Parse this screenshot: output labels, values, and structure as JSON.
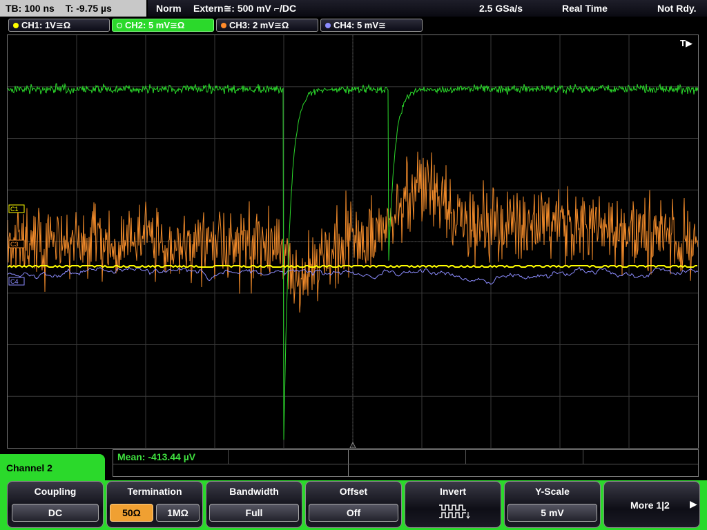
{
  "top_bar": {
    "timebase": "TB: 100 ns",
    "trigger_time": "T: -9.75 µs",
    "acq_mode": "Norm",
    "trigger": "Extern≅: 500 mV ⌐/DC",
    "sample_rate": "2.5 GSa/s",
    "timing_mode": "Real Time",
    "run_state": "Not Rdy."
  },
  "channels": [
    {
      "label": "CH1: 1V≅Ω",
      "color": "#ffff00"
    },
    {
      "label": "CH2: 5 mV≅Ω",
      "color": "#2bd92b",
      "active": true
    },
    {
      "label": "CH3: 2 mV≅Ω",
      "color": "#ff8a2a"
    },
    {
      "label": "CH4: 5 mV≅",
      "color": "#8c8cff"
    }
  ],
  "screen": {
    "trigger_marker": "T▶",
    "trace_labels": [
      "C1",
      "C3",
      "C4"
    ]
  },
  "measurement": {
    "mean": "Mean: -413.44 µV"
  },
  "menu": {
    "title": "Channel 2",
    "softkeys": {
      "coupling": {
        "title": "Coupling",
        "value": "DC"
      },
      "termination": {
        "title": "Termination",
        "option_a": "50Ω",
        "option_b": "1MΩ"
      },
      "bandwidth": {
        "title": "Bandwidth",
        "value": "Full"
      },
      "offset": {
        "title": "Offset",
        "value": "Off"
      },
      "invert": {
        "title": "Invert"
      },
      "yscale": {
        "title": "Y-Scale",
        "value": "5 mV"
      },
      "more": {
        "label": "More 1|2"
      }
    }
  }
}
